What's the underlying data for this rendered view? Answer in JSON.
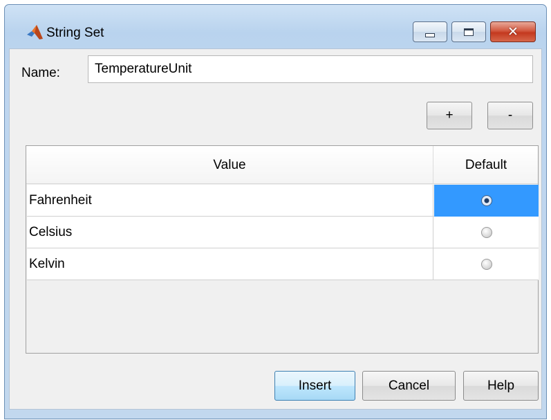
{
  "window": {
    "title": "String Set",
    "icon": "matlab-logo-icon",
    "controls": {
      "minimize": "minimize-icon",
      "maximize": "maximize-icon",
      "close": "close-icon"
    }
  },
  "name_field": {
    "label": "Name:",
    "value": "TemperatureUnit"
  },
  "row_buttons": {
    "add_label": "+",
    "remove_label": "-"
  },
  "table": {
    "columns": [
      "Value",
      "Default"
    ],
    "rows": [
      {
        "value": "Fahrenheit",
        "default": true,
        "selected": true
      },
      {
        "value": "Celsius",
        "default": false,
        "selected": false
      },
      {
        "value": "Kelvin",
        "default": false,
        "selected": false
      }
    ]
  },
  "footer": {
    "insert_label": "Insert",
    "cancel_label": "Cancel",
    "help_label": "Help"
  },
  "colors": {
    "selection": "#3399ff",
    "accent": "#3c7fb1",
    "close_button": "#c4391f"
  }
}
